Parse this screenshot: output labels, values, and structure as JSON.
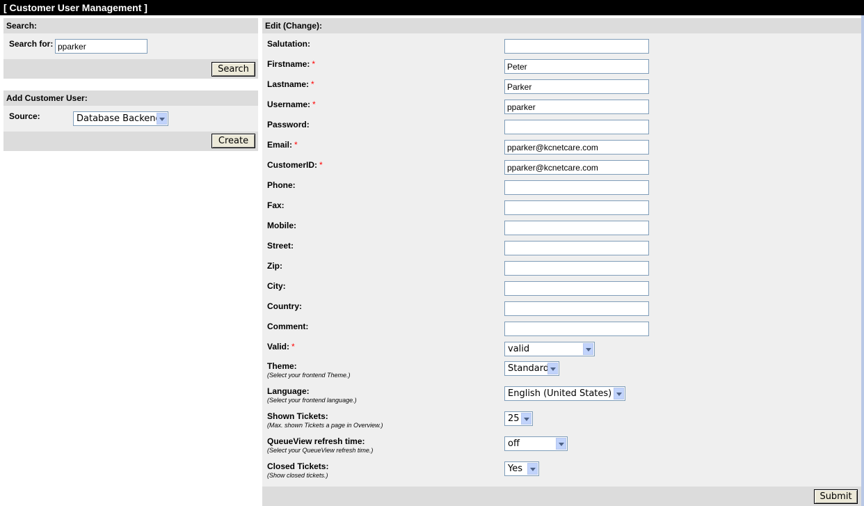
{
  "header": {
    "title": "[ Customer User Management ]"
  },
  "search": {
    "heading": "Search:",
    "label": "Search for:",
    "value": "pparker",
    "button": "Search"
  },
  "add": {
    "heading": "Add Customer User:",
    "source_label": "Source:",
    "source_value": "Database Backend",
    "button": "Create"
  },
  "edit": {
    "heading": "Edit (Change):",
    "required_mark": "*",
    "fields": {
      "salutation": {
        "label": "Salutation:",
        "value": ""
      },
      "firstname": {
        "label": "Firstname:",
        "value": "Peter"
      },
      "lastname": {
        "label": "Lastname:",
        "value": "Parker"
      },
      "username": {
        "label": "Username:",
        "value": "pparker"
      },
      "password": {
        "label": "Password:",
        "value": ""
      },
      "email": {
        "label": "Email:",
        "value": "pparker@kcnetcare.com"
      },
      "customerid": {
        "label": "CustomerID:",
        "value": "pparker@kcnetcare.com"
      },
      "phone": {
        "label": "Phone:",
        "value": ""
      },
      "fax": {
        "label": "Fax:",
        "value": ""
      },
      "mobile": {
        "label": "Mobile:",
        "value": ""
      },
      "street": {
        "label": "Street:",
        "value": ""
      },
      "zip": {
        "label": "Zip:",
        "value": ""
      },
      "city": {
        "label": "City:",
        "value": ""
      },
      "country": {
        "label": "Country:",
        "value": ""
      },
      "comment": {
        "label": "Comment:",
        "value": ""
      }
    },
    "valid": {
      "label": "Valid:",
      "value": "valid"
    },
    "theme": {
      "label": "Theme:",
      "hint": "(Select your frontend Theme.)",
      "value": "Standard"
    },
    "language": {
      "label": "Language:",
      "hint": "(Select your frontend language.)",
      "value": "English (United States)"
    },
    "shown_tickets": {
      "label": "Shown Tickets:",
      "hint": "(Max. shown Tickets a page in Overview.)",
      "value": "25"
    },
    "refresh": {
      "label": "QueueView refresh time:",
      "hint": "(Select your QueueView refresh time.)",
      "value": "off"
    },
    "closed": {
      "label": "Closed Tickets:",
      "hint": "(Show closed tickets.)",
      "value": "Yes"
    },
    "submit": "Submit"
  },
  "colors": {
    "title_bg": "#000000",
    "panel_head": "#dcdcdc",
    "panel_body": "#efefef",
    "required": "#ff0000"
  }
}
